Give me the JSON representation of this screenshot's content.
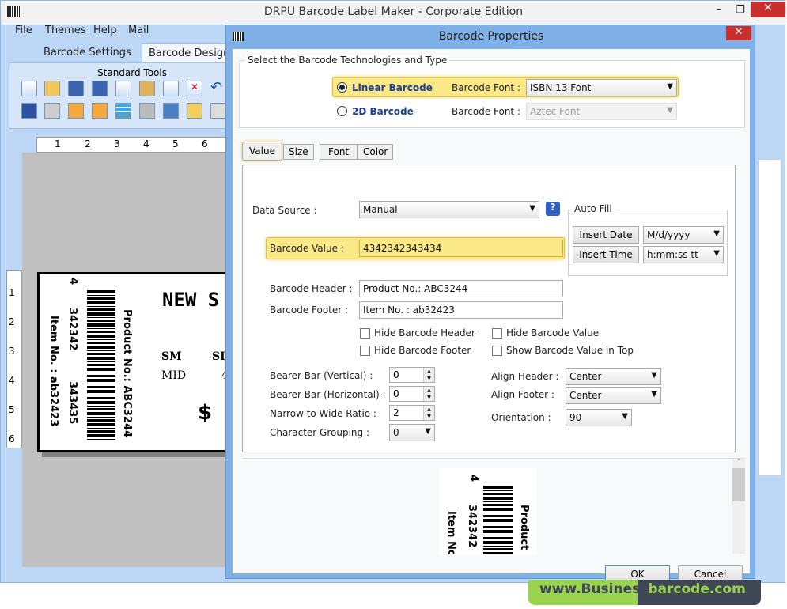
{
  "app": {
    "title": "DRPU Barcode Label Maker - Corporate Edition",
    "menu": [
      "File",
      "Themes",
      "Help",
      "Mail"
    ],
    "tabs": [
      "Barcode Settings",
      "Barcode Designi"
    ],
    "toolbox_title": "Standard Tools"
  },
  "ruler": {
    "top": [
      "1",
      "2",
      "3",
      "4",
      "5",
      "6"
    ],
    "left": [
      "1",
      "2",
      "3",
      "4",
      "5",
      "6"
    ]
  },
  "label": {
    "title": "NEW S",
    "sm": "SM",
    "si": "SI",
    "mid": "MID",
    "mid_val": "4",
    "price": "$",
    "top_digit": "4",
    "digits1": "342342",
    "digits2": "343435",
    "product": "Product No.: ABC3244",
    "item": "Item No. : ab32423"
  },
  "dialog": {
    "title": "Barcode Properties",
    "tech_group": "Select the Barcode Technologies and Type",
    "linear": {
      "label": "Linear Barcode",
      "font_label": "Barcode Font :",
      "font": "ISBN 13 Font",
      "selected": true
    },
    "twod": {
      "label": "2D Barcode",
      "font_label": "Barcode Font :",
      "font": "Aztec Font",
      "selected": false
    },
    "tabs": [
      "Value",
      "Size",
      "Font",
      "Color"
    ],
    "data_source_label": "Data Source :",
    "data_source": "Manual",
    "autofill": {
      "title": "Auto Fill",
      "insert_date": "Insert Date",
      "date_format": "M/d/yyyy",
      "insert_time": "Insert Time",
      "time_format": "h:mm:ss tt"
    },
    "barcode_value_label": "Barcode Value :",
    "barcode_value": "4342342343434",
    "header_label": "Barcode Header :",
    "header": "Product No.: ABC3244",
    "footer_label": "Barcode Footer :",
    "footer": "Item No. : ab32423",
    "checks": [
      {
        "label": "Hide Barcode Header",
        "checked": false
      },
      {
        "label": "Hide Barcode Value",
        "checked": false
      },
      {
        "label": "Hide Barcode Footer",
        "checked": false
      },
      {
        "label": "Show Barcode Value in Top",
        "checked": false
      }
    ],
    "bearer_v_label": "Bearer Bar (Vertical) :",
    "bearer_v": "0",
    "bearer_h_label": "Bearer Bar (Horizontal) :",
    "bearer_h": "0",
    "ratio_label": "Narrow to Wide Ratio :",
    "ratio": "2",
    "grouping_label": "Character Grouping :",
    "grouping": "0",
    "align_header_label": "Align Header  :",
    "align_header": "Center",
    "align_footer_label": "Align Footer  :",
    "align_footer": "Center",
    "orientation_label": "Orientation  :",
    "orientation": "90",
    "preview": {
      "digit": "4",
      "digits": "342342",
      "product": "Product No",
      "item": "Item No."
    },
    "ok": "OK",
    "cancel": "Cancel"
  },
  "brand": {
    "part1": "www.Business",
    "part2": "barcode.com"
  }
}
